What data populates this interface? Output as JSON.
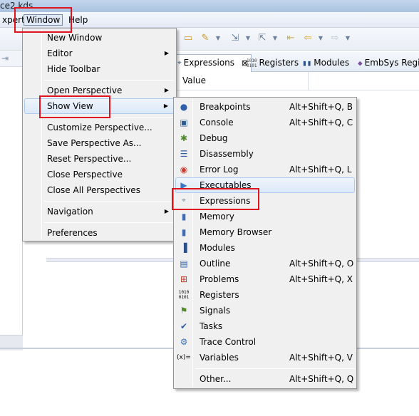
{
  "title_fragment": "ce2.kds",
  "menubar": {
    "items": [
      "xpert",
      "Window",
      "Help"
    ]
  },
  "tabs": [
    {
      "label": "Expressions",
      "icon": "expressions-icon",
      "close": "⊠"
    },
    {
      "label": "Registers",
      "icon": "registers-icon",
      "icon_text": "1010\n0101"
    },
    {
      "label": "Modules",
      "icon": "modules-icon"
    },
    {
      "label": "EmbSys Regi",
      "icon": "embsys-registers-icon"
    }
  ],
  "columns": {
    "value_header": "Value"
  },
  "window_menu": {
    "groups": [
      [
        {
          "label": "New Window"
        },
        {
          "label": "Editor",
          "submenu": true
        },
        {
          "label": "Hide Toolbar"
        }
      ],
      [
        {
          "label": "Open Perspective",
          "submenu": true
        },
        {
          "label": "Show View",
          "submenu": true,
          "highlighted": true
        }
      ],
      [
        {
          "label": "Customize Perspective..."
        },
        {
          "label": "Save Perspective As..."
        },
        {
          "label": "Reset Perspective..."
        },
        {
          "label": "Close Perspective"
        },
        {
          "label": "Close All Perspectives"
        }
      ],
      [
        {
          "label": "Navigation",
          "submenu": true
        }
      ],
      [
        {
          "label": "Preferences"
        }
      ]
    ]
  },
  "show_view_menu": {
    "items": [
      {
        "label": "Breakpoints",
        "shortcut": "Alt+Shift+Q, B",
        "icon": "breakpoints-icon"
      },
      {
        "label": "Console",
        "shortcut": "Alt+Shift+Q, C",
        "icon": "console-icon"
      },
      {
        "label": "Debug",
        "shortcut": "",
        "icon": "debug-icon"
      },
      {
        "label": "Disassembly",
        "shortcut": "",
        "icon": "disassembly-icon"
      },
      {
        "label": "Error Log",
        "shortcut": "Alt+Shift+Q, L",
        "icon": "error-log-icon"
      },
      {
        "label": "Executables",
        "shortcut": "",
        "icon": "executables-icon",
        "highlighted": true
      },
      {
        "label": "Expressions",
        "shortcut": "",
        "icon": "expressions-icon"
      },
      {
        "label": "Memory",
        "shortcut": "",
        "icon": "memory-icon"
      },
      {
        "label": "Memory Browser",
        "shortcut": "",
        "icon": "memory-browser-icon"
      },
      {
        "label": "Modules",
        "shortcut": "",
        "icon": "modules-icon"
      },
      {
        "label": "Outline",
        "shortcut": "Alt+Shift+Q, O",
        "icon": "outline-icon"
      },
      {
        "label": "Problems",
        "shortcut": "Alt+Shift+Q, X",
        "icon": "problems-icon"
      },
      {
        "label": "Registers",
        "shortcut": "",
        "icon": "registers-icon",
        "icon_text": "1010\n0101"
      },
      {
        "label": "Signals",
        "shortcut": "",
        "icon": "signals-icon"
      },
      {
        "label": "Tasks",
        "shortcut": "",
        "icon": "tasks-icon"
      },
      {
        "label": "Trace Control",
        "shortcut": "",
        "icon": "trace-control-icon"
      },
      {
        "label": "Variables",
        "shortcut": "Alt+Shift+Q, V",
        "icon": "variables-icon",
        "icon_text": "(x)="
      }
    ],
    "other": {
      "label": "Other...",
      "shortcut": "Alt+Shift+Q, Q"
    }
  },
  "colors": {
    "callout": "#e0141e",
    "highlight_border": "#aecbef",
    "menu_bg": "#f0f0f0"
  }
}
